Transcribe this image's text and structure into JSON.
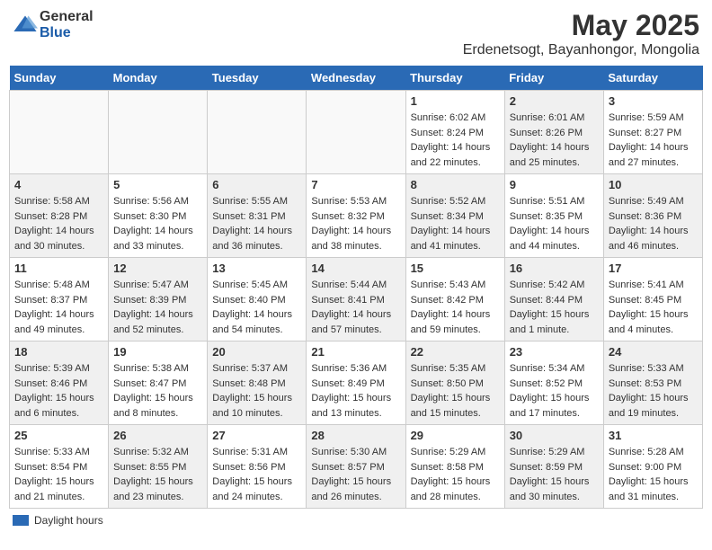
{
  "logo": {
    "general": "General",
    "blue": "Blue"
  },
  "title": "May 2025",
  "subtitle": "Erdenetsogt, Bayanhongor, Mongolia",
  "headers": [
    "Sunday",
    "Monday",
    "Tuesday",
    "Wednesday",
    "Thursday",
    "Friday",
    "Saturday"
  ],
  "weeks": [
    [
      {
        "day": "",
        "data": "",
        "shaded": false,
        "empty": true
      },
      {
        "day": "",
        "data": "",
        "shaded": false,
        "empty": true
      },
      {
        "day": "",
        "data": "",
        "shaded": false,
        "empty": true
      },
      {
        "day": "",
        "data": "",
        "shaded": false,
        "empty": true
      },
      {
        "day": "1",
        "data": "Sunrise: 6:02 AM\nSunset: 8:24 PM\nDaylight: 14 hours\nand 22 minutes.",
        "shaded": false,
        "empty": false
      },
      {
        "day": "2",
        "data": "Sunrise: 6:01 AM\nSunset: 8:26 PM\nDaylight: 14 hours\nand 25 minutes.",
        "shaded": true,
        "empty": false
      },
      {
        "day": "3",
        "data": "Sunrise: 5:59 AM\nSunset: 8:27 PM\nDaylight: 14 hours\nand 27 minutes.",
        "shaded": false,
        "empty": false
      }
    ],
    [
      {
        "day": "4",
        "data": "Sunrise: 5:58 AM\nSunset: 8:28 PM\nDaylight: 14 hours\nand 30 minutes.",
        "shaded": true,
        "empty": false
      },
      {
        "day": "5",
        "data": "Sunrise: 5:56 AM\nSunset: 8:30 PM\nDaylight: 14 hours\nand 33 minutes.",
        "shaded": false,
        "empty": false
      },
      {
        "day": "6",
        "data": "Sunrise: 5:55 AM\nSunset: 8:31 PM\nDaylight: 14 hours\nand 36 minutes.",
        "shaded": true,
        "empty": false
      },
      {
        "day": "7",
        "data": "Sunrise: 5:53 AM\nSunset: 8:32 PM\nDaylight: 14 hours\nand 38 minutes.",
        "shaded": false,
        "empty": false
      },
      {
        "day": "8",
        "data": "Sunrise: 5:52 AM\nSunset: 8:34 PM\nDaylight: 14 hours\nand 41 minutes.",
        "shaded": true,
        "empty": false
      },
      {
        "day": "9",
        "data": "Sunrise: 5:51 AM\nSunset: 8:35 PM\nDaylight: 14 hours\nand 44 minutes.",
        "shaded": false,
        "empty": false
      },
      {
        "day": "10",
        "data": "Sunrise: 5:49 AM\nSunset: 8:36 PM\nDaylight: 14 hours\nand 46 minutes.",
        "shaded": true,
        "empty": false
      }
    ],
    [
      {
        "day": "11",
        "data": "Sunrise: 5:48 AM\nSunset: 8:37 PM\nDaylight: 14 hours\nand 49 minutes.",
        "shaded": false,
        "empty": false
      },
      {
        "day": "12",
        "data": "Sunrise: 5:47 AM\nSunset: 8:39 PM\nDaylight: 14 hours\nand 52 minutes.",
        "shaded": true,
        "empty": false
      },
      {
        "day": "13",
        "data": "Sunrise: 5:45 AM\nSunset: 8:40 PM\nDaylight: 14 hours\nand 54 minutes.",
        "shaded": false,
        "empty": false
      },
      {
        "day": "14",
        "data": "Sunrise: 5:44 AM\nSunset: 8:41 PM\nDaylight: 14 hours\nand 57 minutes.",
        "shaded": true,
        "empty": false
      },
      {
        "day": "15",
        "data": "Sunrise: 5:43 AM\nSunset: 8:42 PM\nDaylight: 14 hours\nand 59 minutes.",
        "shaded": false,
        "empty": false
      },
      {
        "day": "16",
        "data": "Sunrise: 5:42 AM\nSunset: 8:44 PM\nDaylight: 15 hours\nand 1 minute.",
        "shaded": true,
        "empty": false
      },
      {
        "day": "17",
        "data": "Sunrise: 5:41 AM\nSunset: 8:45 PM\nDaylight: 15 hours\nand 4 minutes.",
        "shaded": false,
        "empty": false
      }
    ],
    [
      {
        "day": "18",
        "data": "Sunrise: 5:39 AM\nSunset: 8:46 PM\nDaylight: 15 hours\nand 6 minutes.",
        "shaded": true,
        "empty": false
      },
      {
        "day": "19",
        "data": "Sunrise: 5:38 AM\nSunset: 8:47 PM\nDaylight: 15 hours\nand 8 minutes.",
        "shaded": false,
        "empty": false
      },
      {
        "day": "20",
        "data": "Sunrise: 5:37 AM\nSunset: 8:48 PM\nDaylight: 15 hours\nand 10 minutes.",
        "shaded": true,
        "empty": false
      },
      {
        "day": "21",
        "data": "Sunrise: 5:36 AM\nSunset: 8:49 PM\nDaylight: 15 hours\nand 13 minutes.",
        "shaded": false,
        "empty": false
      },
      {
        "day": "22",
        "data": "Sunrise: 5:35 AM\nSunset: 8:50 PM\nDaylight: 15 hours\nand 15 minutes.",
        "shaded": true,
        "empty": false
      },
      {
        "day": "23",
        "data": "Sunrise: 5:34 AM\nSunset: 8:52 PM\nDaylight: 15 hours\nand 17 minutes.",
        "shaded": false,
        "empty": false
      },
      {
        "day": "24",
        "data": "Sunrise: 5:33 AM\nSunset: 8:53 PM\nDaylight: 15 hours\nand 19 minutes.",
        "shaded": true,
        "empty": false
      }
    ],
    [
      {
        "day": "25",
        "data": "Sunrise: 5:33 AM\nSunset: 8:54 PM\nDaylight: 15 hours\nand 21 minutes.",
        "shaded": false,
        "empty": false
      },
      {
        "day": "26",
        "data": "Sunrise: 5:32 AM\nSunset: 8:55 PM\nDaylight: 15 hours\nand 23 minutes.",
        "shaded": true,
        "empty": false
      },
      {
        "day": "27",
        "data": "Sunrise: 5:31 AM\nSunset: 8:56 PM\nDaylight: 15 hours\nand 24 minutes.",
        "shaded": false,
        "empty": false
      },
      {
        "day": "28",
        "data": "Sunrise: 5:30 AM\nSunset: 8:57 PM\nDaylight: 15 hours\nand 26 minutes.",
        "shaded": true,
        "empty": false
      },
      {
        "day": "29",
        "data": "Sunrise: 5:29 AM\nSunset: 8:58 PM\nDaylight: 15 hours\nand 28 minutes.",
        "shaded": false,
        "empty": false
      },
      {
        "day": "30",
        "data": "Sunrise: 5:29 AM\nSunset: 8:59 PM\nDaylight: 15 hours\nand 30 minutes.",
        "shaded": true,
        "empty": false
      },
      {
        "day": "31",
        "data": "Sunrise: 5:28 AM\nSunset: 9:00 PM\nDaylight: 15 hours\nand 31 minutes.",
        "shaded": false,
        "empty": false
      }
    ]
  ],
  "legend": {
    "daylight_label": "Daylight hours"
  }
}
